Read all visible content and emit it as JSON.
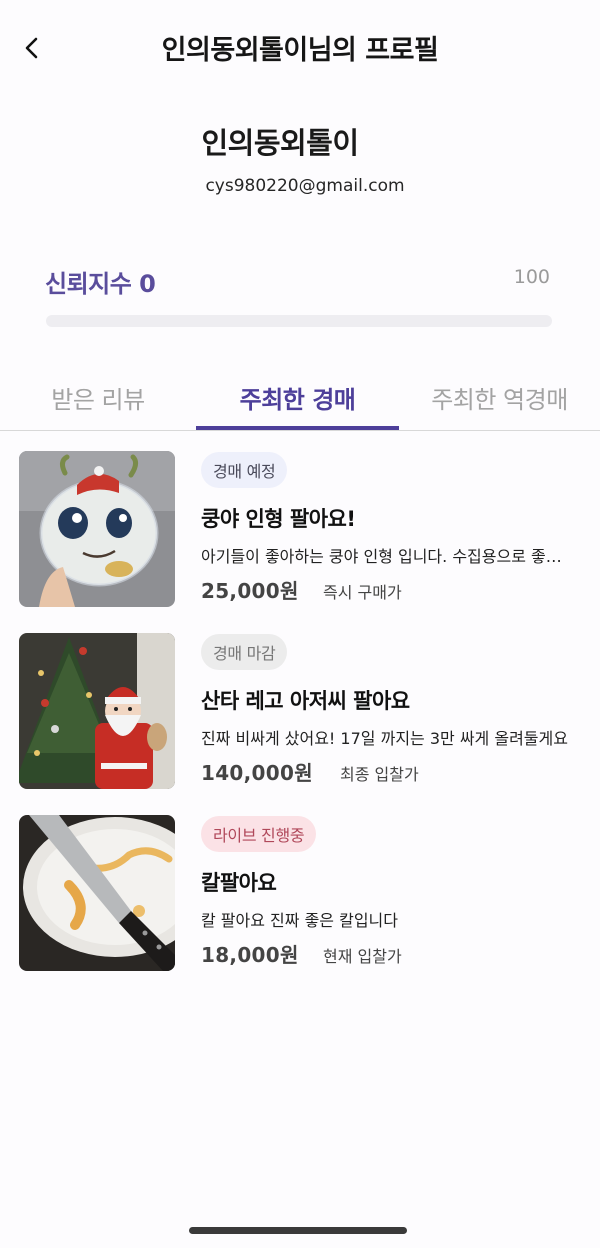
{
  "header": {
    "title": "인의동외톨이님의 프로필",
    "back_icon": "chevron-left-icon"
  },
  "profile": {
    "nickname": "인의동외톨이",
    "email": "cys980220@gmail.com"
  },
  "trust": {
    "label": "신뢰지수 0",
    "max_label": "100",
    "value": 0,
    "max": 100,
    "accent": "#5a4d9c"
  },
  "tabs": [
    {
      "label": "받은 리뷰",
      "active": false
    },
    {
      "label": "주최한 경매",
      "active": true
    },
    {
      "label": "주최한 역경매",
      "active": false
    }
  ],
  "auctions": [
    {
      "status": "경매 예정",
      "status_bg": "#eef0fb",
      "status_color": "#4a4a5a",
      "title": "쿵야 인형 팔아요!",
      "description": "아기들이 좋아하는 쿵야 인형 입니다. 수집용으로 좋아요",
      "price": "25,000원",
      "price_type": "즉시 구매가"
    },
    {
      "status": "경매 마감",
      "status_bg": "#ececec",
      "status_color": "#777777",
      "title": "산타 레고 아저씨 팔아요",
      "description": "진짜 비싸게 샀어요! 17일 까지는 3만 싸게 올려둘게요",
      "price": "140,000원",
      "price_type": "최종 입찰가"
    },
    {
      "status": "라이브 진행중",
      "status_bg": "#fbe2e6",
      "status_color": "#b0485a",
      "title": "칼팔아요",
      "description": "칼 팔아요 진짜 좋은 칼입니다",
      "price": "18,000원",
      "price_type": "현재 입찰가"
    }
  ]
}
